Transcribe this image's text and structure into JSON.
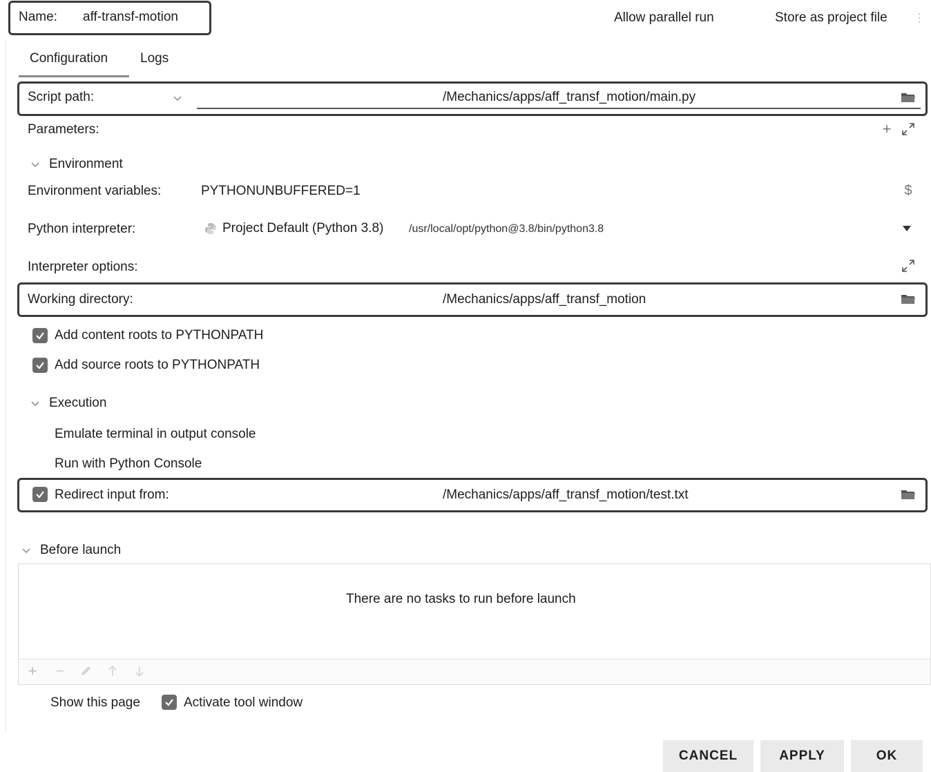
{
  "header": {
    "name_label": "Name:",
    "name_value": "aff-transf-motion",
    "allow_parallel_run": "Allow parallel run",
    "store_as_project_file": "Store as project file"
  },
  "tabs": [
    {
      "label": "Configuration",
      "active": true
    },
    {
      "label": "Logs",
      "active": false
    }
  ],
  "config": {
    "script_path_label": "Script path:",
    "script_path_value": "/Mechanics/apps/aff_transf_motion/main.py",
    "parameters_label": "Parameters:",
    "environment_section": "Environment",
    "env_vars_label": "Environment variables:",
    "env_vars_value": "PYTHONUNBUFFERED=1",
    "interpreter_label": "Python interpreter:",
    "interpreter_name": "Project Default (Python 3.8)",
    "interpreter_path": "/usr/local/opt/python@3.8/bin/python3.8",
    "interpreter_options_label": "Interpreter options:",
    "working_dir_label": "Working directory:",
    "working_dir_value": "/Mechanics/apps/aff_transf_motion",
    "add_content_roots": "Add content roots to PYTHONPATH",
    "add_source_roots": "Add source roots to PYTHONPATH",
    "execution_section": "Execution",
    "emulate_terminal": "Emulate terminal in output console",
    "run_with_console": "Run with Python Console",
    "redirect_input_label": "Redirect input from:",
    "redirect_input_value": "/Mechanics/apps/aff_transf_motion/test.txt"
  },
  "before_launch": {
    "section": "Before launch",
    "empty_text": "There are no tasks to run before launch",
    "show_this_page": "Show this page",
    "activate_tool_window": "Activate tool window"
  },
  "buttons": {
    "cancel": "CANCEL",
    "apply": "APPLY",
    "ok": "OK"
  },
  "colors": {
    "highlight_border": "#3a3a3a",
    "checkbox_fill": "#6b6b6b",
    "button_bg": "#eaeaea"
  }
}
